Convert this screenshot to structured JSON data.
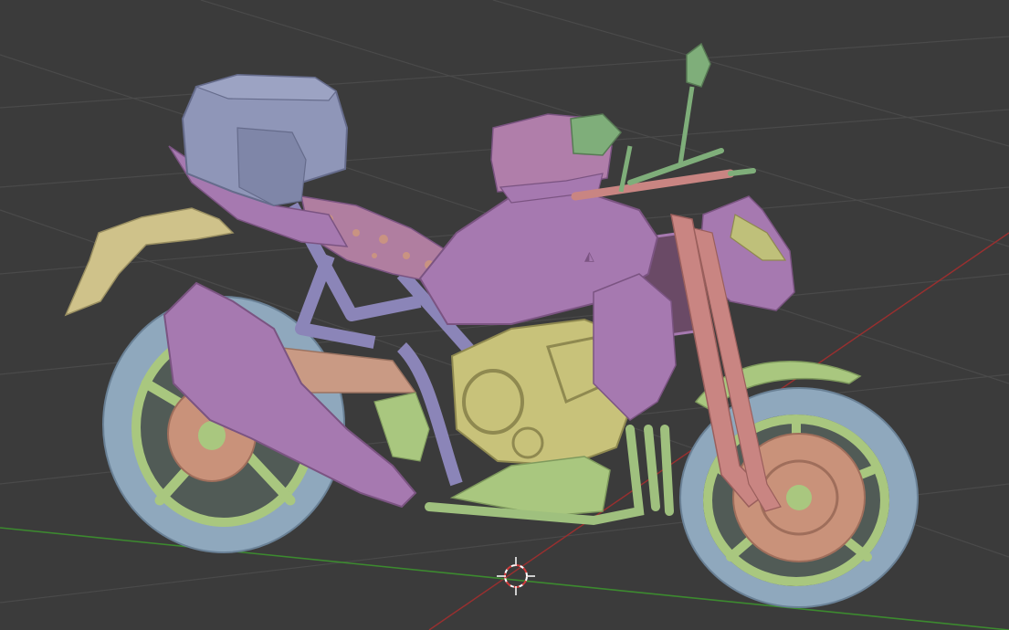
{
  "viewport": {
    "background": "#3b3b3b",
    "grid_color": "#4a4a4a",
    "x_axis_color": "#9a2f2f",
    "y_axis_color": "#3c8a2f"
  },
  "scene": {
    "object": "motorcycle",
    "material_colors": {
      "tire": "#8fa8bd",
      "rim": "#a9c77f",
      "disc": "#c9927a",
      "bodywork": "#a679b0",
      "frame": "#8b85b8",
      "engine": "#c8c27a",
      "fork": "#c98582",
      "bag": "#8f96b8",
      "rear_fender": "#cfc28a",
      "exhaust_pipes": "#9fc07e",
      "mirror": "#7fae7a"
    }
  },
  "cursor_3d": {
    "icon": "3d-cursor-icon"
  }
}
